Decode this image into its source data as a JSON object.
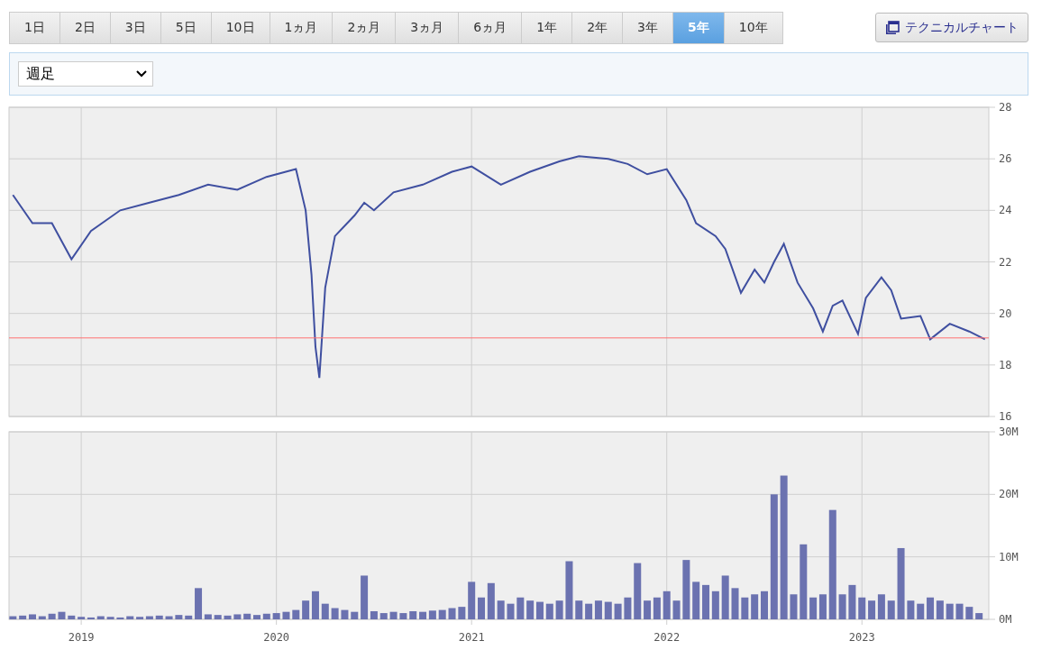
{
  "period_tabs": [
    {
      "label": "1日",
      "selected": false
    },
    {
      "label": "2日",
      "selected": false
    },
    {
      "label": "3日",
      "selected": false
    },
    {
      "label": "5日",
      "selected": false
    },
    {
      "label": "10日",
      "selected": false
    },
    {
      "label": "1ヵ月",
      "selected": false
    },
    {
      "label": "2ヵ月",
      "selected": false
    },
    {
      "label": "3ヵ月",
      "selected": false
    },
    {
      "label": "6ヵ月",
      "selected": false
    },
    {
      "label": "1年",
      "selected": false
    },
    {
      "label": "2年",
      "selected": false
    },
    {
      "label": "3年",
      "selected": false
    },
    {
      "label": "5年",
      "selected": true
    },
    {
      "label": "10年",
      "selected": false
    }
  ],
  "technical_chart_button": {
    "label": "テクニカルチャート"
  },
  "interval_select": {
    "value": "週足"
  },
  "price_chart": {
    "chart_data": {
      "type": "line",
      "grid": true,
      "xlim": [
        2018.63,
        2023.65
      ],
      "ylim": [
        16,
        28
      ],
      "yticks": [
        {
          "value": 16,
          "label": "16"
        },
        {
          "value": 18,
          "label": "18"
        },
        {
          "value": 20,
          "label": "20"
        },
        {
          "value": 22,
          "label": "22"
        },
        {
          "value": 24,
          "label": "24"
        },
        {
          "value": 26,
          "label": "26"
        },
        {
          "value": 28,
          "label": "28"
        }
      ],
      "x": [
        2018.65,
        2018.75,
        2018.85,
        2018.95,
        2019.05,
        2019.2,
        2019.35,
        2019.5,
        2019.65,
        2019.8,
        2019.95,
        2020.1,
        2020.15,
        2020.18,
        2020.2,
        2020.22,
        2020.25,
        2020.3,
        2020.4,
        2020.45,
        2020.5,
        2020.6,
        2020.75,
        2020.9,
        2021.0,
        2021.15,
        2021.3,
        2021.45,
        2021.55,
        2021.7,
        2021.8,
        2021.9,
        2022.0,
        2022.1,
        2022.15,
        2022.25,
        2022.3,
        2022.38,
        2022.45,
        2022.5,
        2022.55,
        2022.6,
        2022.67,
        2022.75,
        2022.8,
        2022.85,
        2022.9,
        2022.98,
        2023.02,
        2023.1,
        2023.15,
        2023.2,
        2023.3,
        2023.35,
        2023.45,
        2023.55,
        2023.63
      ],
      "series": [
        {
          "color": "#3f4fa0",
          "values": [
            24.6,
            23.5,
            23.5,
            22.1,
            23.2,
            24.0,
            24.3,
            24.6,
            25.0,
            24.8,
            25.3,
            25.6,
            24.0,
            21.5,
            18.7,
            17.5,
            21.0,
            23.0,
            23.8,
            24.3,
            24.0,
            24.7,
            25.0,
            25.5,
            25.7,
            25.0,
            25.5,
            25.9,
            26.1,
            26.0,
            25.8,
            25.4,
            25.6,
            24.4,
            23.5,
            23.0,
            22.5,
            20.8,
            21.7,
            21.2,
            22.0,
            22.7,
            21.2,
            20.2,
            19.3,
            20.3,
            20.5,
            19.2,
            20.6,
            21.4,
            20.9,
            19.8,
            19.9,
            19.0,
            19.6,
            19.3,
            19.0
          ]
        }
      ],
      "ref_lines": [
        {
          "axis": "y",
          "value": 19.05,
          "color": "#ff7070"
        }
      ]
    }
  },
  "volume_chart": {
    "chart_data": {
      "type": "bar",
      "grid": true,
      "xlim": [
        2018.63,
        2023.65
      ],
      "ylim": [
        0,
        30
      ],
      "xticks": [
        {
          "value": 2019,
          "label": "2019"
        },
        {
          "value": 2020,
          "label": "2020"
        },
        {
          "value": 2021,
          "label": "2021"
        },
        {
          "value": 2022,
          "label": "2022"
        },
        {
          "value": 2023,
          "label": "2023"
        }
      ],
      "yticks": [
        {
          "value": 0,
          "label": "0M"
        },
        {
          "value": 10,
          "label": "10M"
        },
        {
          "value": 20,
          "label": "20M"
        },
        {
          "value": 30,
          "label": "30M"
        }
      ],
      "x": [
        2018.65,
        2018.7,
        2018.75,
        2018.8,
        2018.85,
        2018.9,
        2018.95,
        2019.0,
        2019.05,
        2019.1,
        2019.15,
        2019.2,
        2019.25,
        2019.3,
        2019.35,
        2019.4,
        2019.45,
        2019.5,
        2019.55,
        2019.6,
        2019.65,
        2019.7,
        2019.75,
        2019.8,
        2019.85,
        2019.9,
        2019.95,
        2020.0,
        2020.05,
        2020.1,
        2020.15,
        2020.2,
        2020.25,
        2020.3,
        2020.35,
        2020.4,
        2020.45,
        2020.5,
        2020.55,
        2020.6,
        2020.65,
        2020.7,
        2020.75,
        2020.8,
        2020.85,
        2020.9,
        2020.95,
        2021.0,
        2021.05,
        2021.1,
        2021.15,
        2021.2,
        2021.25,
        2021.3,
        2021.35,
        2021.4,
        2021.45,
        2021.5,
        2021.55,
        2021.6,
        2021.65,
        2021.7,
        2021.75,
        2021.8,
        2021.85,
        2021.9,
        2021.95,
        2022.0,
        2022.05,
        2022.1,
        2022.15,
        2022.2,
        2022.25,
        2022.3,
        2022.35,
        2022.4,
        2022.45,
        2022.5,
        2022.55,
        2022.6,
        2022.65,
        2022.7,
        2022.75,
        2022.8,
        2022.85,
        2022.9,
        2022.95,
        2023.0,
        2023.05,
        2023.1,
        2023.15,
        2023.2,
        2023.25,
        2023.3,
        2023.35,
        2023.4,
        2023.45,
        2023.5,
        2023.55,
        2023.6
      ],
      "series": [
        {
          "color": "#6b72b0",
          "values": [
            0.5,
            0.6,
            0.8,
            0.5,
            0.9,
            1.2,
            0.6,
            0.4,
            0.3,
            0.5,
            0.4,
            0.3,
            0.5,
            0.4,
            0.5,
            0.6,
            0.5,
            0.7,
            0.6,
            5.0,
            0.8,
            0.7,
            0.6,
            0.8,
            0.9,
            0.7,
            0.9,
            1.0,
            1.2,
            1.5,
            3.0,
            4.5,
            2.5,
            1.8,
            1.5,
            1.2,
            7.0,
            1.3,
            1.0,
            1.2,
            1.0,
            1.3,
            1.2,
            1.4,
            1.5,
            1.8,
            2.0,
            6.0,
            3.5,
            5.8,
            3.0,
            2.5,
            3.5,
            3.0,
            2.8,
            2.5,
            3.0,
            9.3,
            3.0,
            2.5,
            3.0,
            2.8,
            2.5,
            3.5,
            9.0,
            3.0,
            3.5,
            4.5,
            3.0,
            9.5,
            6.0,
            5.5,
            4.5,
            7.0,
            5.0,
            3.5,
            4.0,
            4.5,
            20.0,
            23.0,
            4.0,
            12.0,
            3.5,
            4.0,
            17.5,
            4.0,
            5.5,
            3.5,
            3.0,
            4.0,
            3.0,
            11.4,
            3.0,
            2.5,
            3.5,
            3.0,
            2.5,
            2.5,
            2.0,
            1.0
          ]
        }
      ]
    }
  }
}
